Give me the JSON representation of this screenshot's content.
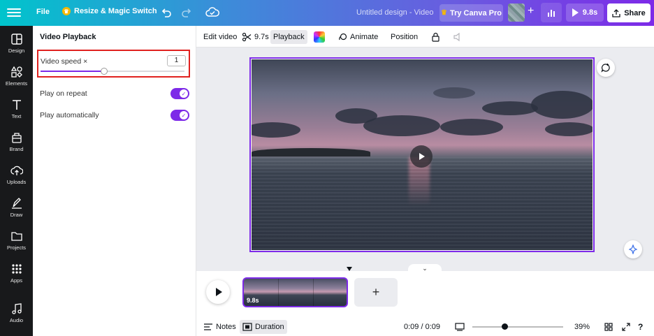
{
  "topbar": {
    "file_label": "File",
    "resize_label": "Resize & Magic Switch",
    "doc_title": "Untitled design - Video",
    "try_pro_label": "Try Canva Pro",
    "play_duration": "9.8s",
    "share_label": "Share"
  },
  "rail": {
    "items": [
      {
        "label": "Design",
        "icon": "design-icon"
      },
      {
        "label": "Elements",
        "icon": "elements-icon"
      },
      {
        "label": "Text",
        "icon": "text-icon"
      },
      {
        "label": "Brand",
        "icon": "brand-icon"
      },
      {
        "label": "Uploads",
        "icon": "uploads-icon"
      },
      {
        "label": "Draw",
        "icon": "draw-icon"
      },
      {
        "label": "Projects",
        "icon": "projects-icon"
      },
      {
        "label": "Apps",
        "icon": "apps-icon"
      },
      {
        "label": "Audio",
        "icon": "audio-icon"
      }
    ]
  },
  "panel": {
    "title": "Video Playback",
    "speed_label": "Video speed ×",
    "speed_value": "1",
    "speed_slider_fraction": 0.44,
    "repeat_label": "Play on repeat",
    "repeat_on": true,
    "auto_label": "Play automatically",
    "auto_on": true
  },
  "toolbar": {
    "edit_video": "Edit video",
    "trim_duration": "9.7s",
    "playback": "Playback",
    "animate": "Animate",
    "position": "Position"
  },
  "timeline": {
    "clip_duration": "9.8s",
    "add_label": "+"
  },
  "footer": {
    "notes": "Notes",
    "duration": "Duration",
    "time": "0:09 / 0:09",
    "zoom_fraction": 0.35,
    "zoom_percent": "39%"
  },
  "colors": {
    "accent": "#7d2ae8",
    "highlight_box": "#e0211f",
    "rail_bg": "#18191b"
  }
}
